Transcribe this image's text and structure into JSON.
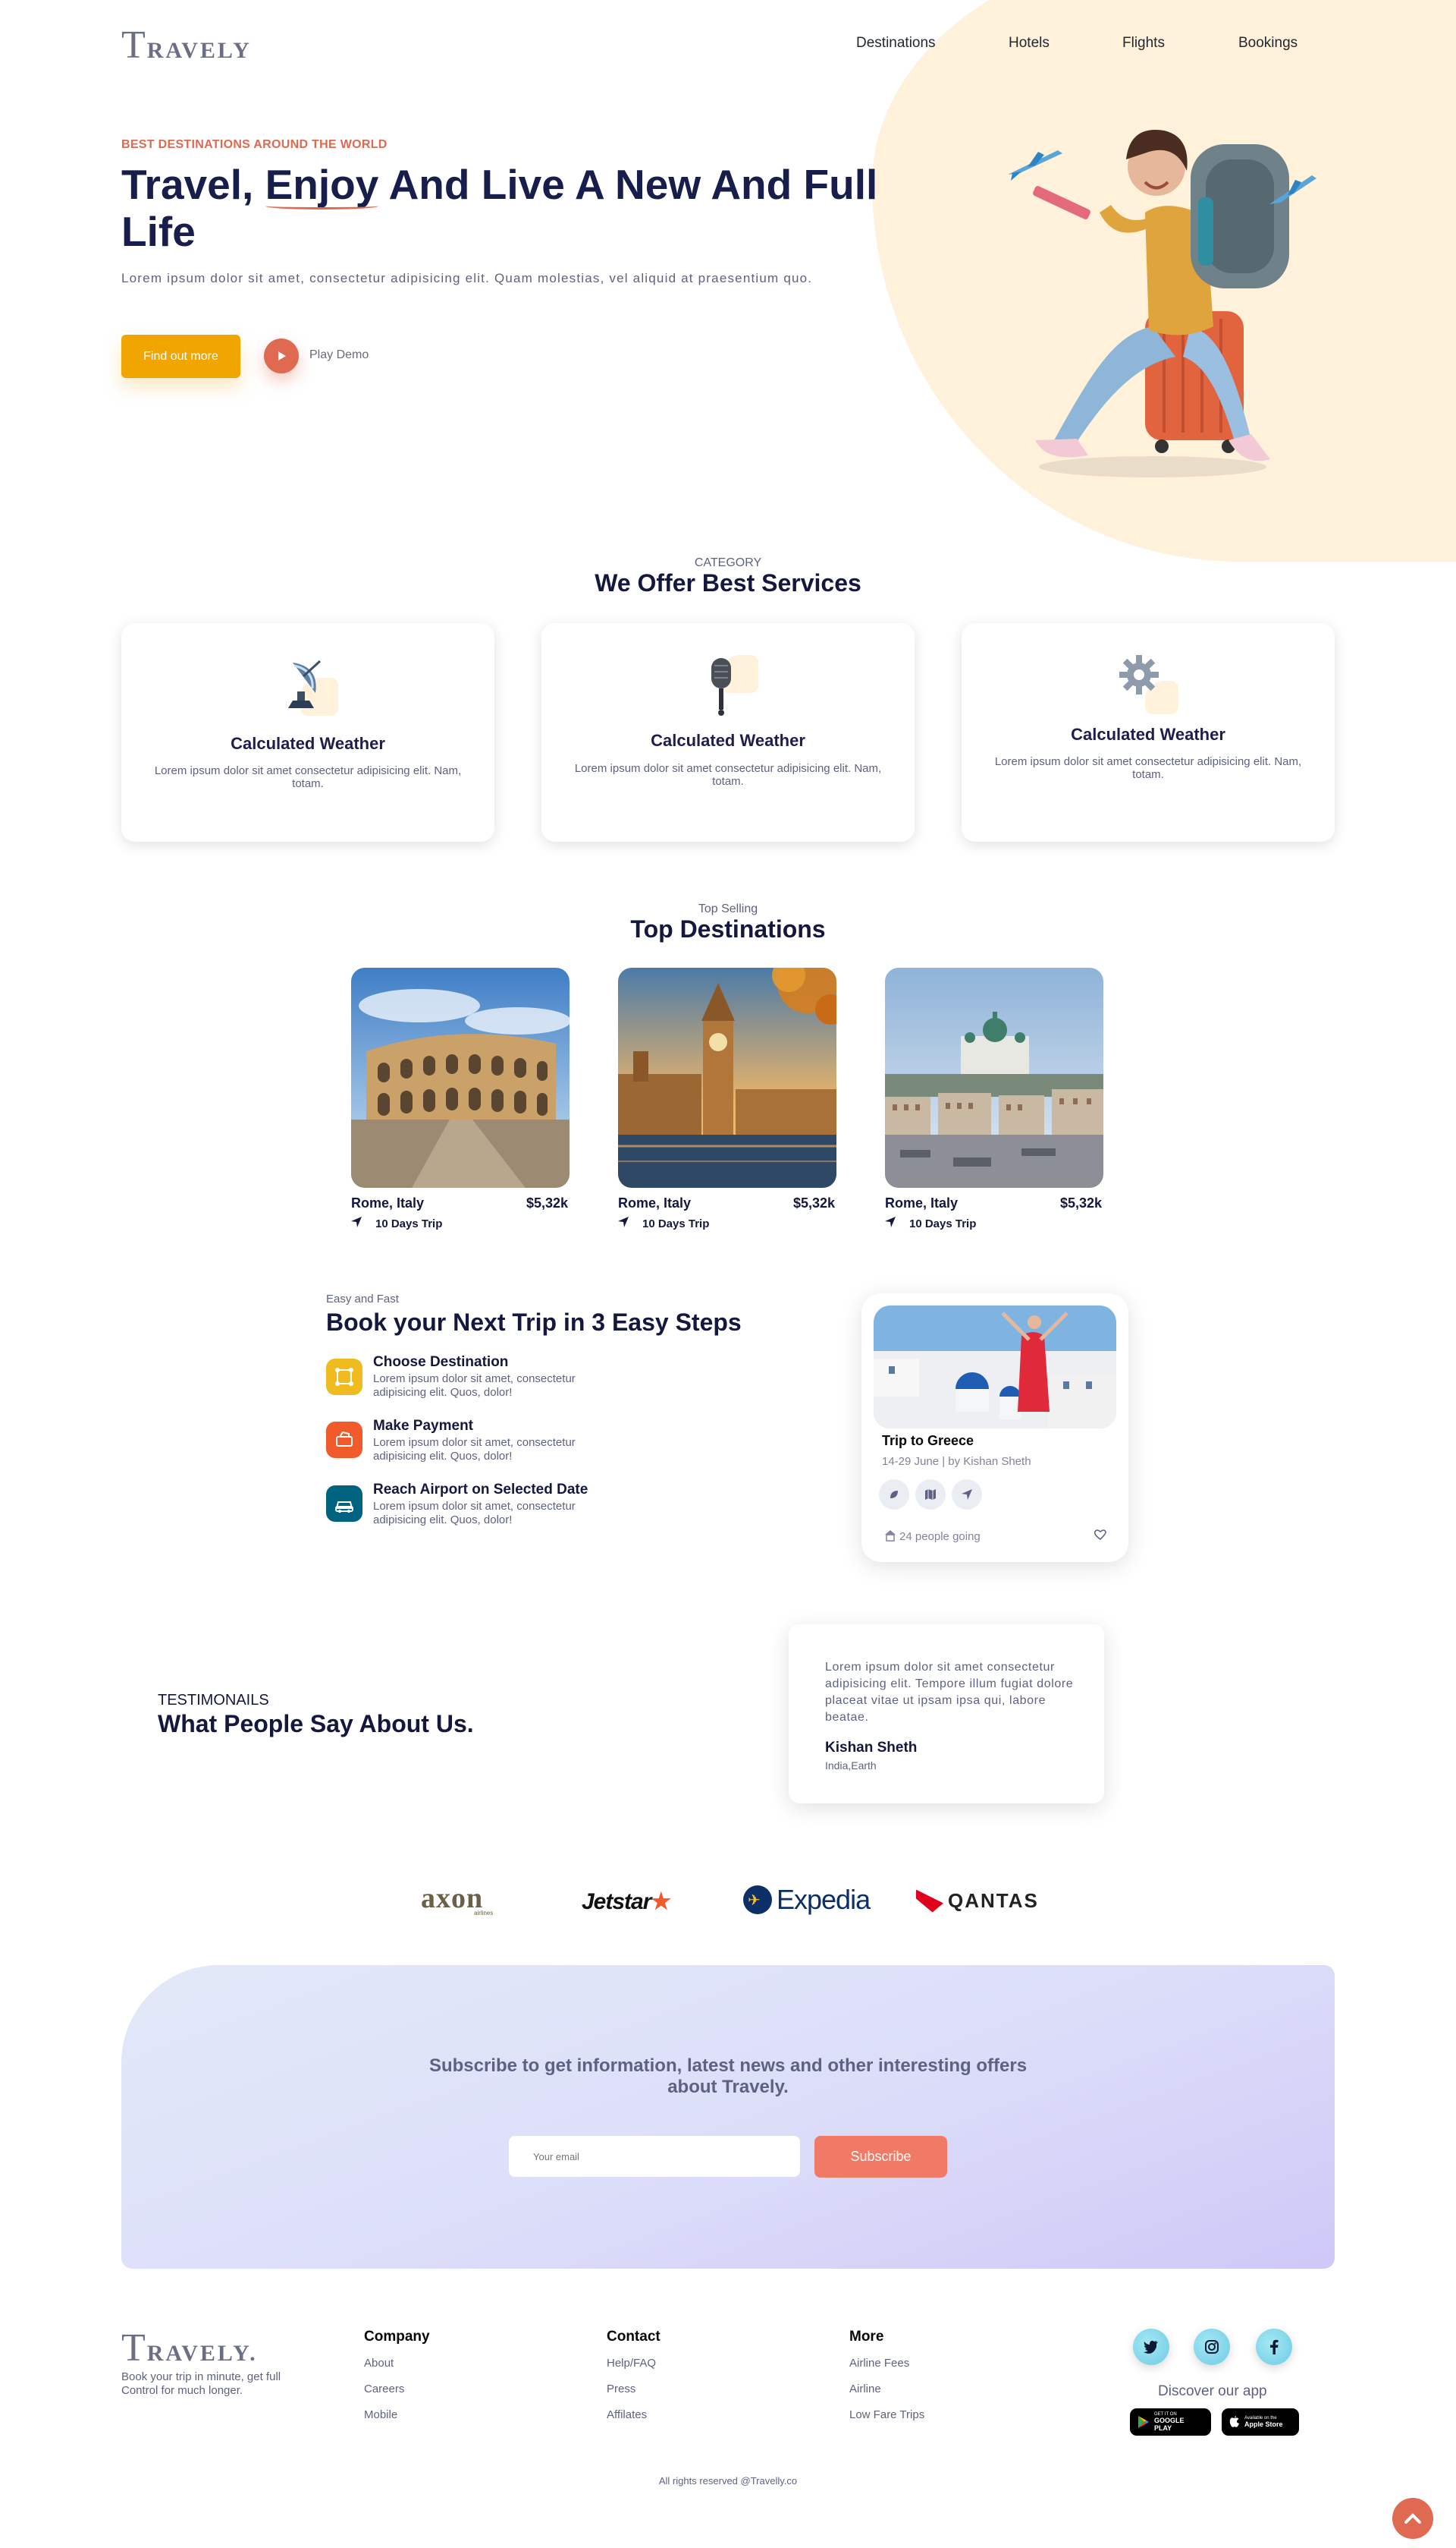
{
  "brand": {
    "logo_initial": "T",
    "logo_rest": "RAVELY"
  },
  "nav": [
    "Destinations",
    "Hotels",
    "Flights",
    "Bookings"
  ],
  "hero": {
    "eyebrow": "BEST DESTINATIONS AROUND THE WORLD",
    "title_part1": "Travel, ",
    "title_underlined": "Enjoy",
    "title_part2": " And Live A New And Full Life",
    "subtitle": "Lorem ipsum dolor sit amet, consectetur adipisicing elit. Quam molestias, vel aliquid at praesentium quo.",
    "cta_label": "Find out more",
    "play_label": "Play Demo"
  },
  "services": {
    "small": "CATEGORY",
    "title": "We Offer Best Services",
    "cards": [
      {
        "icon": "satellite-dish-icon",
        "title": "Calculated Weather",
        "text": "Lorem ipsum dolor sit amet consectetur adipisicing elit. Nam, totam."
      },
      {
        "icon": "microphone-icon",
        "title": "Calculated Weather",
        "text": "Lorem ipsum dolor sit amet consectetur adipisicing elit. Nam, totam."
      },
      {
        "icon": "gear-icon",
        "title": "Calculated Weather",
        "text": "Lorem ipsum dolor sit amet consectetur adipisicing elit. Nam, totam."
      }
    ]
  },
  "destinations": {
    "small": "Top Selling",
    "title": "Top Destinations",
    "items": [
      {
        "name": "Rome, Italy",
        "price": "$5,32k",
        "trip": "10 Days Trip",
        "image": "colosseum-photo"
      },
      {
        "name": "Rome, Italy",
        "price": "$5,32k",
        "trip": "10 Days Trip",
        "image": "big-ben-photo"
      },
      {
        "name": "Rome, Italy",
        "price": "$5,32k",
        "trip": "10 Days Trip",
        "image": "helsinki-cathedral-photo"
      }
    ]
  },
  "steps": {
    "small": "Easy and Fast",
    "title": "Book your Next Trip in 3 Easy Steps",
    "items": [
      {
        "title": "Choose Destination",
        "text": "Lorem ipsum dolor sit amet, consectetur adipisicing elit. Quos, dolor!",
        "color": "#F0BB1F",
        "icon": "destination-icon"
      },
      {
        "title": "Make Payment",
        "text": "Lorem ipsum dolor sit amet, consectetur adipisicing elit. Quos, dolor!",
        "color": "#F15A2B",
        "icon": "payment-icon"
      },
      {
        "title": "Reach Airport on Selected Date",
        "text": "Lorem ipsum dolor sit amet, consectetur adipisicing elit. Quos, dolor!",
        "color": "#006380",
        "icon": "taxi-icon"
      }
    ]
  },
  "trip_card": {
    "title": "Trip to Greece",
    "meta": "14-29 June | by Kishan Sheth",
    "going": "24 people going",
    "image": "santorini-photo"
  },
  "testimonials": {
    "small": "TESTIMONAILS",
    "title": "What People Say About Us.",
    "quote": "Lorem ipsum dolor sit amet consectetur adipisicing elit. Tempore illum fugiat dolore placeat vitae ut ipsam ipsa qui, labore beatae.",
    "name": "Kishan Sheth",
    "location": "India,Earth"
  },
  "partners": [
    "axon",
    "Jetstar",
    "Expedia",
    "QANTAS"
  ],
  "partners_sub": {
    "axon": "airlines"
  },
  "subscribe": {
    "text": "Subscribe to get information, latest news and other interesting offers about Travely.",
    "placeholder": "Your email",
    "button": "Subscribe"
  },
  "footer": {
    "logo_initial": "T",
    "logo_rest": "RAVELY.",
    "tagline": "Book your trip in minute, get full Control for much longer.",
    "columns": [
      {
        "title": "Company",
        "links": [
          "About",
          "Careers",
          "Mobile"
        ]
      },
      {
        "title": "Contact",
        "links": [
          "Help/FAQ",
          "Press",
          "Affilates"
        ]
      },
      {
        "title": "More",
        "links": [
          "Airline Fees",
          "Airline",
          "Low Fare Trips"
        ]
      }
    ],
    "discover": "Discover our app",
    "google_small": "GET IT ON",
    "google_big": "GOOGLE PLAY",
    "apple_small": "Available on the",
    "apple_big": "Apple Store",
    "copyright": "All rights reserved @Travelly.co"
  },
  "colors": {
    "accent": "#DF6951",
    "primary_button": "#F1A501",
    "heading": "#181E4B",
    "hero_blob": "#FFF1DA"
  }
}
